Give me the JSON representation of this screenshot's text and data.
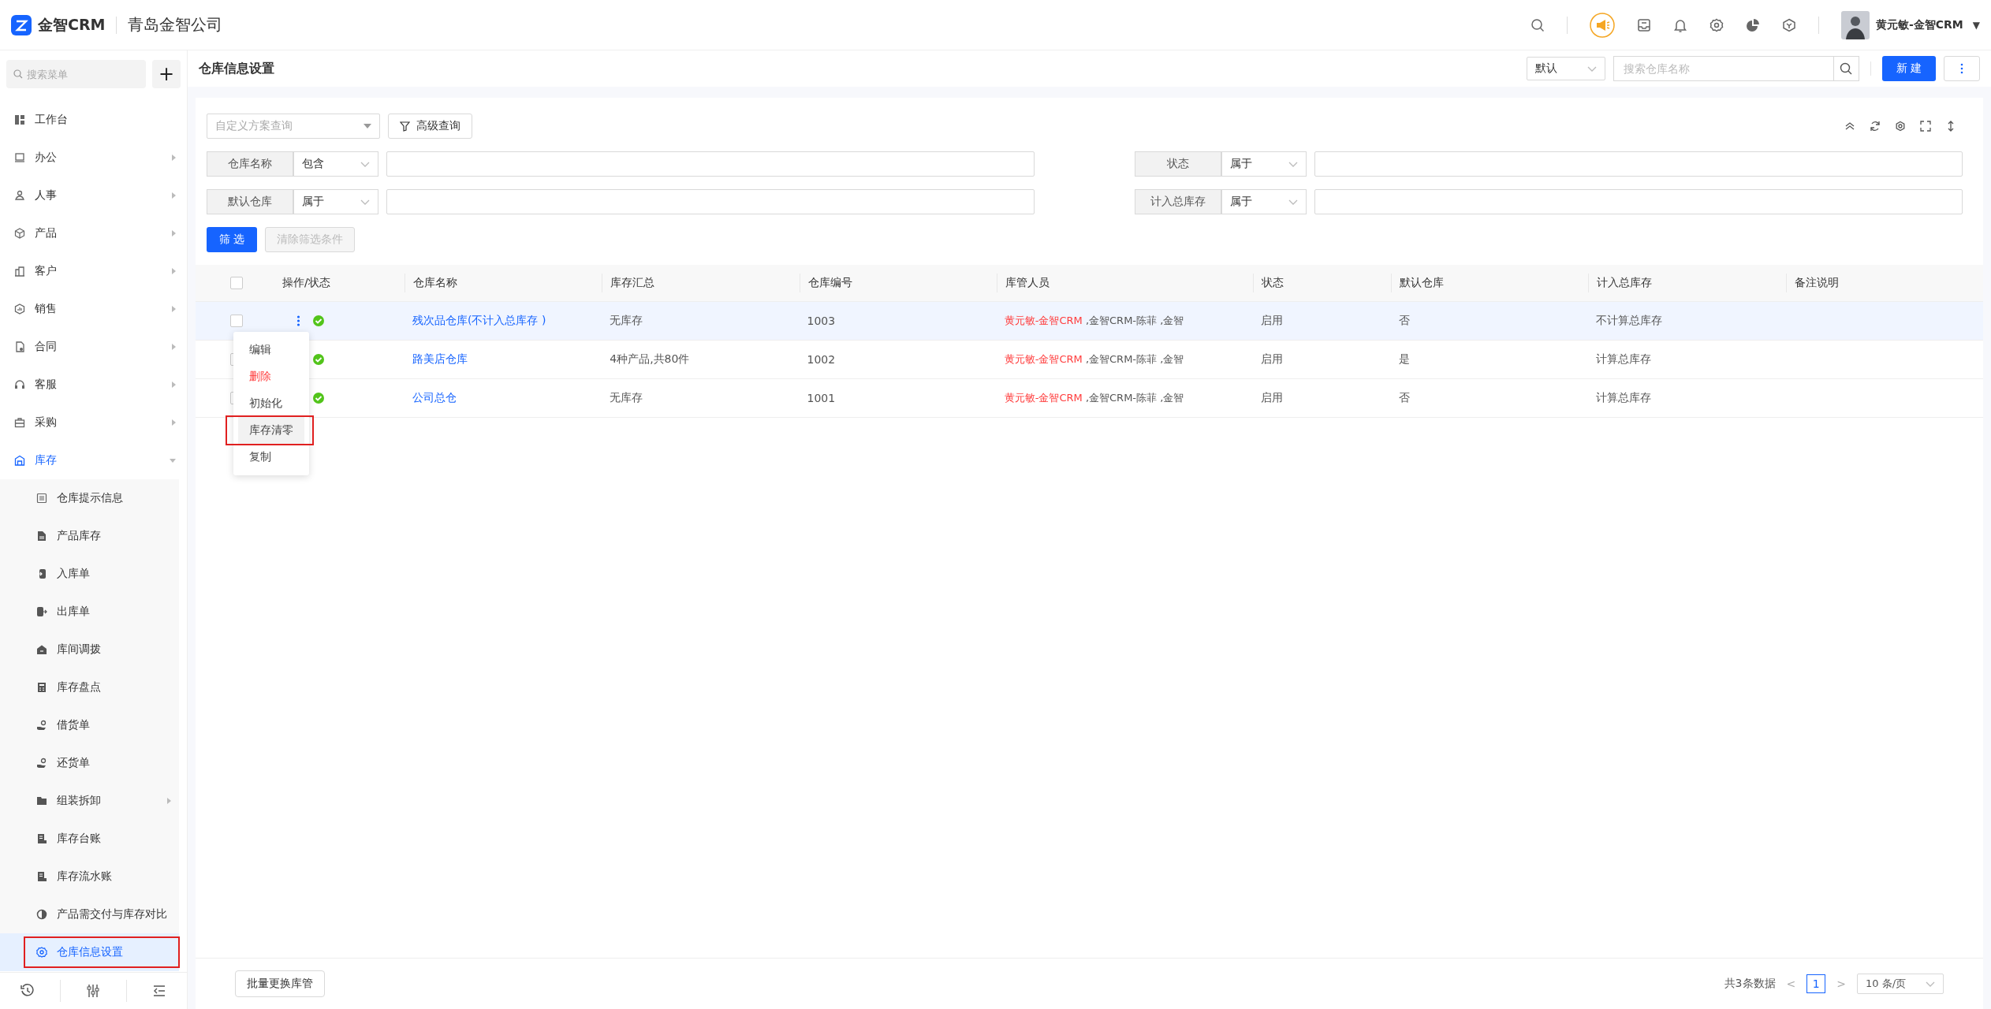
{
  "app": {
    "name": "金智CRM",
    "company": "青岛金智公司"
  },
  "user": {
    "name": "黄元敏-金智CRM",
    "caret": "▼"
  },
  "sidebar": {
    "search": {
      "placeholder": "搜索菜单"
    },
    "add": "+",
    "items": [
      {
        "label": "工作台",
        "has_arrow": false,
        "expanded": false
      },
      {
        "label": "办公",
        "has_arrow": true,
        "expanded": false
      },
      {
        "label": "人事",
        "has_arrow": true,
        "expanded": false
      },
      {
        "label": "产品",
        "has_arrow": true,
        "expanded": false
      },
      {
        "label": "客户",
        "has_arrow": true,
        "expanded": false
      },
      {
        "label": "销售",
        "has_arrow": true,
        "expanded": false
      },
      {
        "label": "合同",
        "has_arrow": true,
        "expanded": false
      },
      {
        "label": "客服",
        "has_arrow": true,
        "expanded": false
      },
      {
        "label": "采购",
        "has_arrow": true,
        "expanded": false
      },
      {
        "label": "库存",
        "has_arrow": true,
        "expanded": true,
        "children": [
          {
            "label": "仓库提示信息",
            "has_arrow": false,
            "selected": false,
            "annotated": false
          },
          {
            "label": "产品库存",
            "has_arrow": false,
            "selected": false,
            "annotated": false
          },
          {
            "label": "入库单",
            "has_arrow": false,
            "selected": false,
            "annotated": false
          },
          {
            "label": "出库单",
            "has_arrow": false,
            "selected": false,
            "annotated": false
          },
          {
            "label": "库间调拨",
            "has_arrow": false,
            "selected": false,
            "annotated": false
          },
          {
            "label": "库存盘点",
            "has_arrow": false,
            "selected": false,
            "annotated": false
          },
          {
            "label": "借货单",
            "has_arrow": false,
            "selected": false,
            "annotated": false
          },
          {
            "label": "还货单",
            "has_arrow": false,
            "selected": false,
            "annotated": false
          },
          {
            "label": "组装拆卸",
            "has_arrow": true,
            "selected": false,
            "annotated": false
          },
          {
            "label": "库存台账",
            "has_arrow": false,
            "selected": false,
            "annotated": false
          },
          {
            "label": "库存流水账",
            "has_arrow": false,
            "selected": false,
            "annotated": false
          },
          {
            "label": "产品需交付与库存对比",
            "has_arrow": false,
            "selected": false,
            "annotated": false
          },
          {
            "label": "仓库信息设置",
            "has_arrow": false,
            "selected": true,
            "annotated": true
          }
        ]
      }
    ]
  },
  "page": {
    "title": "仓库信息设置",
    "view_select": "默认",
    "search": {
      "placeholder": "搜索仓库名称"
    },
    "new_button": "新 建"
  },
  "filter": {
    "scheme": {
      "placeholder": "自定义方案查询"
    },
    "advanced": "高级查询",
    "fields": [
      {
        "label": "仓库名称",
        "operator": "包含"
      },
      {
        "label": "状态",
        "operator": "属于"
      },
      {
        "label": "默认仓库",
        "operator": "属于"
      },
      {
        "label": "计入总库存",
        "operator": "属于"
      }
    ],
    "apply": "筛 选",
    "clear": {
      "label": "清除筛选条件",
      "disabled": true
    }
  },
  "table": {
    "columns": [
      "操作/状态",
      "仓库名称",
      "库存汇总",
      "仓库编号",
      "库管人员",
      "状态",
      "默认仓库",
      "计入总库存",
      "备注说明"
    ],
    "header_checked": false,
    "rows": [
      {
        "checked": false,
        "highlighted": true,
        "enabled": true,
        "name": "残次品仓库(不计入总库存 )",
        "summary": "无库存",
        "code": "1003",
        "manager_main": "黄元敏-金智CRM",
        "manager_rest": " ,金智CRM-陈菲 ,金智",
        "status": "启用",
        "default": "否",
        "total": "不计算总库存",
        "actions_menu": [
          {
            "label": "编辑",
            "kind": "normal",
            "hovered": false,
            "annotated": false
          },
          {
            "label": "删除",
            "kind": "danger",
            "hovered": false,
            "annotated": false
          },
          {
            "label": "初始化",
            "kind": "normal",
            "hovered": false,
            "annotated": false
          },
          {
            "label": "库存清零",
            "kind": "normal",
            "hovered": true,
            "annotated": true
          },
          {
            "label": "复制",
            "kind": "normal",
            "hovered": false,
            "annotated": false
          }
        ]
      },
      {
        "checked": false,
        "highlighted": false,
        "enabled": true,
        "name": "路美店仓库",
        "summary": "4种产品,共80件",
        "code": "1002",
        "manager_main": "黄元敏-金智CRM",
        "manager_rest": " ,金智CRM-陈菲 ,金智",
        "status": "启用",
        "default": "是",
        "total": "计算总库存"
      },
      {
        "checked": false,
        "highlighted": false,
        "enabled": true,
        "name": "公司总仓",
        "summary": "无库存",
        "code": "1001",
        "manager_main": "黄元敏-金智CRM",
        "manager_rest": " ,金智CRM-陈菲 ,金智",
        "status": "启用",
        "default": "否",
        "total": "计算总库存"
      }
    ]
  },
  "footer": {
    "batch_button": "批量更换库管",
    "total": "共3条数据",
    "prev": "<",
    "pages": [
      {
        "label": "1",
        "selected": true
      }
    ],
    "next": ">",
    "page_size": "10 条/页"
  }
}
